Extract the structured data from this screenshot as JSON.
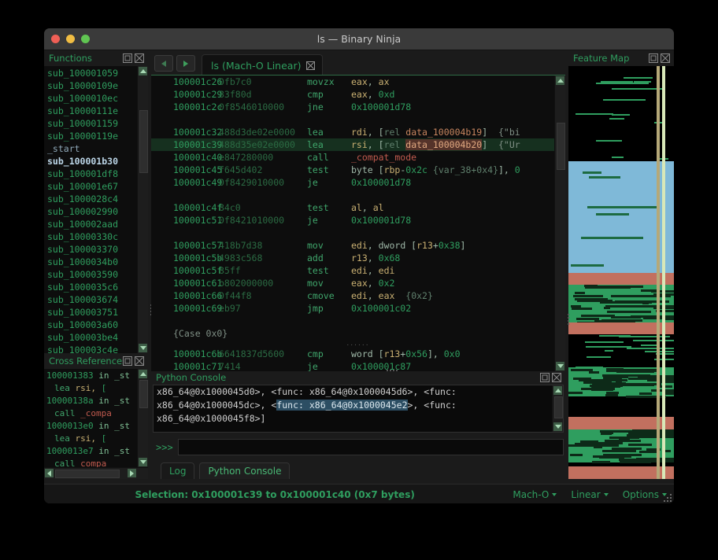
{
  "window": {
    "title": "ls — Binary Ninja",
    "traffic_lights": [
      "close-red",
      "minimize-yellow",
      "maximize-green"
    ]
  },
  "panels": {
    "functions": {
      "title": "Functions",
      "detach_icon": "detach-icon",
      "close_icon": "close-icon"
    },
    "cross_references": {
      "title": "Cross References",
      "detach_icon": "detach-icon",
      "close_icon": "close-icon"
    },
    "python_console": {
      "title": "Python Console",
      "detach_icon": "detach-icon",
      "close_icon": "close-icon"
    },
    "feature_map": {
      "title": "Feature Map",
      "detach_icon": "detach-icon",
      "close_icon": "close-icon"
    }
  },
  "functions_list": [
    {
      "label": "sub_100001059",
      "state": "normal"
    },
    {
      "label": "sub_10000109e",
      "state": "normal"
    },
    {
      "label": "sub_1000010ec",
      "state": "normal"
    },
    {
      "label": "sub_10000111e",
      "state": "normal"
    },
    {
      "label": "sub_100001159",
      "state": "normal"
    },
    {
      "label": "sub_10000119e",
      "state": "normal"
    },
    {
      "label": "_start",
      "state": "symbol"
    },
    {
      "label": "sub_100001b30",
      "state": "current"
    },
    {
      "label": "sub_100001df8",
      "state": "normal"
    },
    {
      "label": "sub_100001e67",
      "state": "normal"
    },
    {
      "label": "sub_1000028c4",
      "state": "normal"
    },
    {
      "label": "sub_100002990",
      "state": "normal"
    },
    {
      "label": "sub_100002aad",
      "state": "normal"
    },
    {
      "label": "sub_10000330c",
      "state": "normal"
    },
    {
      "label": "sub_100003370",
      "state": "normal"
    },
    {
      "label": "sub_1000034b0",
      "state": "normal"
    },
    {
      "label": "sub_100003590",
      "state": "normal"
    },
    {
      "label": "sub_1000035c6",
      "state": "normal"
    },
    {
      "label": "sub_100003674",
      "state": "normal"
    },
    {
      "label": "sub_100003751",
      "state": "normal"
    },
    {
      "label": "sub_100003a60",
      "state": "normal"
    },
    {
      "label": "sub_100003be4",
      "state": "normal"
    },
    {
      "label": "sub_100003c4e",
      "state": "clipped"
    }
  ],
  "tabbar": {
    "back_icon": "arrow-left-icon",
    "forward_icon": "arrow-right-icon",
    "tabs": [
      {
        "label": "ls (Mach-O Linear)",
        "close_icon": "close-icon",
        "active": true
      }
    ]
  },
  "disassembly": [
    {
      "type": "code",
      "addr": "100001c26",
      "bytes": "0fb7c0",
      "mnemonic": "movzx",
      "operands": [
        {
          "t": "reg",
          "v": "eax"
        },
        {
          "t": "plain",
          "v": ", "
        },
        {
          "t": "reg",
          "v": "ax"
        }
      ]
    },
    {
      "type": "code",
      "addr": "100001c29",
      "bytes": "83f80d",
      "mnemonic": "cmp",
      "operands": [
        {
          "t": "reg",
          "v": "eax"
        },
        {
          "t": "plain",
          "v": ", "
        },
        {
          "t": "num",
          "v": "0xd"
        }
      ]
    },
    {
      "type": "code",
      "addr": "100001c2c",
      "bytes": "0f8546010000",
      "mnemonic": "jne",
      "operands": [
        {
          "t": "addr",
          "v": "0x100001d78"
        }
      ]
    },
    {
      "type": "blank"
    },
    {
      "type": "code",
      "addr": "100001c32",
      "bytes": "488d3de02e0000",
      "mnemonic": "lea",
      "operands": [
        {
          "t": "reg",
          "v": "rdi"
        },
        {
          "t": "plain",
          "v": ", ["
        },
        {
          "t": "ann",
          "v": "rel "
        },
        {
          "t": "dref",
          "v": "data_100004b19"
        },
        {
          "t": "plain",
          "v": "]  "
        },
        {
          "t": "cmt",
          "v": "{\"bi"
        }
      ]
    },
    {
      "type": "code",
      "selected": true,
      "addr": "100001c39",
      "bytes": "488d35e02e0000",
      "mnemonic": "lea",
      "operands": [
        {
          "t": "reg",
          "v": "rsi"
        },
        {
          "t": "plain",
          "v": ", ["
        },
        {
          "t": "ann",
          "v": "rel "
        },
        {
          "t": "dref_hl",
          "v": "data_100004b20"
        },
        {
          "t": "plain",
          "v": "]  "
        },
        {
          "t": "cmt",
          "v": "{\"Ur"
        }
      ]
    },
    {
      "type": "code",
      "addr": "100001c40",
      "bytes": "e847280000",
      "mnemonic": "call",
      "operands": [
        {
          "t": "fname",
          "v": "_compat_mode"
        }
      ]
    },
    {
      "type": "code",
      "addr": "100001c45",
      "bytes": "f645d402",
      "mnemonic": "test",
      "operands": [
        {
          "t": "plain",
          "v": "byte ["
        },
        {
          "t": "reg",
          "v": "rbp"
        },
        {
          "t": "plain",
          "v": "-"
        },
        {
          "t": "num",
          "v": "0x2c"
        },
        {
          "t": "plain",
          "v": " "
        },
        {
          "t": "ann",
          "v": "{var_38+0x4}"
        },
        {
          "t": "plain",
          "v": "], "
        },
        {
          "t": "num",
          "v": "0"
        }
      ]
    },
    {
      "type": "code",
      "addr": "100001c49",
      "bytes": "0f8429010000",
      "mnemonic": "je",
      "operands": [
        {
          "t": "addr",
          "v": "0x100001d78"
        }
      ]
    },
    {
      "type": "blank"
    },
    {
      "type": "code",
      "addr": "100001c4f",
      "bytes": "84c0",
      "mnemonic": "test",
      "operands": [
        {
          "t": "reg",
          "v": "al"
        },
        {
          "t": "plain",
          "v": ", "
        },
        {
          "t": "reg",
          "v": "al"
        }
      ]
    },
    {
      "type": "code",
      "addr": "100001c51",
      "bytes": "0f8421010000",
      "mnemonic": "je",
      "operands": [
        {
          "t": "addr",
          "v": "0x100001d78"
        }
      ]
    },
    {
      "type": "blank"
    },
    {
      "type": "code",
      "addr": "100001c57",
      "bytes": "418b7d38",
      "mnemonic": "mov",
      "operands": [
        {
          "t": "reg",
          "v": "edi"
        },
        {
          "t": "plain",
          "v": ", dword ["
        },
        {
          "t": "reg",
          "v": "r13"
        },
        {
          "t": "plain",
          "v": "+"
        },
        {
          "t": "num",
          "v": "0x38"
        },
        {
          "t": "plain",
          "v": "]"
        }
      ]
    },
    {
      "type": "code",
      "addr": "100001c5b",
      "bytes": "4983c568",
      "mnemonic": "add",
      "operands": [
        {
          "t": "reg",
          "v": "r13"
        },
        {
          "t": "plain",
          "v": ", "
        },
        {
          "t": "num",
          "v": "0x68"
        }
      ]
    },
    {
      "type": "code",
      "addr": "100001c5f",
      "bytes": "85ff",
      "mnemonic": "test",
      "operands": [
        {
          "t": "reg",
          "v": "edi"
        },
        {
          "t": "plain",
          "v": ", "
        },
        {
          "t": "reg",
          "v": "edi"
        }
      ]
    },
    {
      "type": "code",
      "addr": "100001c61",
      "bytes": "b802000000",
      "mnemonic": "mov",
      "operands": [
        {
          "t": "reg",
          "v": "eax"
        },
        {
          "t": "plain",
          "v": ", "
        },
        {
          "t": "num",
          "v": "0x2"
        }
      ]
    },
    {
      "type": "code",
      "addr": "100001c66",
      "bytes": "0f44f8",
      "mnemonic": "cmove",
      "operands": [
        {
          "t": "reg",
          "v": "edi"
        },
        {
          "t": "plain",
          "v": ", "
        },
        {
          "t": "reg",
          "v": "eax"
        },
        {
          "t": "plain",
          "v": "  "
        },
        {
          "t": "ann",
          "v": "{0x2}"
        }
      ]
    },
    {
      "type": "code",
      "addr": "100001c69",
      "bytes": "eb97",
      "mnemonic": "jmp",
      "operands": [
        {
          "t": "addr",
          "v": "0x100001c02"
        }
      ]
    },
    {
      "type": "blank"
    },
    {
      "type": "label",
      "text": "{Case 0x0}"
    },
    {
      "type": "code",
      "addr": "100001c6b",
      "bytes": "6641837d5600",
      "mnemonic": "cmp",
      "operands": [
        {
          "t": "plain",
          "v": "word ["
        },
        {
          "t": "reg",
          "v": "r13"
        },
        {
          "t": "plain",
          "v": "+"
        },
        {
          "t": "num",
          "v": "0x56"
        },
        {
          "t": "plain",
          "v": "], "
        },
        {
          "t": "num",
          "v": "0x0"
        }
      ]
    },
    {
      "type": "code",
      "addr": "100001c71",
      "bytes": "7414",
      "mnemonic": "je",
      "operands": [
        {
          "t": "addr",
          "v": "0x100001c87"
        }
      ]
    }
  ],
  "cross_references": [
    {
      "kind": "header",
      "addr": "100001383",
      "in": "in _st"
    },
    {
      "kind": "detail",
      "mnemonic": "lea",
      "operands": "rsi, ["
    },
    {
      "kind": "header",
      "addr": "10000138a",
      "in": "in _st"
    },
    {
      "kind": "detail",
      "mnemonic": "call",
      "target": "_compa"
    },
    {
      "kind": "header",
      "addr": "1000013e0",
      "in": "in _st"
    },
    {
      "kind": "detail",
      "mnemonic": "lea",
      "operands": "rsi, ["
    },
    {
      "kind": "header",
      "addr": "1000013e7",
      "in": "in _st"
    },
    {
      "kind": "detail",
      "mnemonic": "call",
      "target": "compa"
    }
  ],
  "python_console": {
    "output_lines": [
      {
        "segments": [
          {
            "t": "plain",
            "v": "x86_64@0x1000045d0>, <func: x86_64@0x1000045d6>, <func:"
          }
        ]
      },
      {
        "segments": [
          {
            "t": "plain",
            "v": "x86_64@0x1000045dc>, <"
          },
          {
            "t": "hl",
            "v": "func: x86_64@0x1000045e2"
          },
          {
            "t": "plain",
            "v": ">, <func:"
          }
        ]
      },
      {
        "segments": [
          {
            "t": "plain",
            "v": "x86_64@0x1000045f8>]"
          }
        ]
      }
    ],
    "prompt": ">>>",
    "input_value": "",
    "input_placeholder": ""
  },
  "bottom_tabs": [
    {
      "label": "Log",
      "active": false
    },
    {
      "label": "Python Console",
      "active": true
    }
  ],
  "statusbar": {
    "selection": "Selection: 0x100001c39 to 0x100001c40 (0x7 bytes)",
    "items": [
      {
        "label": "Mach-O",
        "caret_icon": "chevron-down-icon"
      },
      {
        "label": "Linear",
        "caret_icon": "chevron-down-icon"
      },
      {
        "label": "Options",
        "caret_icon": "chevron-down-icon"
      }
    ],
    "resize_grip_icon": "resize-grip-icon"
  },
  "colors": {
    "accent_green": "#2f9e5f",
    "data_region_blue": "#7fb9d8",
    "code_region_green": "#2f9e5f",
    "header_region_red": "#c2705f",
    "selection_row": "#16301f",
    "dref_highlight": "#55332a",
    "console_highlight": "#2c4e63",
    "window_chrome": "#3a3a3a",
    "panel_bg": "#1b1b1b",
    "view_bg": "#0d0d0d"
  },
  "feature_map": {
    "marker_position_pct": 88,
    "regions": [
      {
        "name": "symbols-sparse",
        "color": "#000000",
        "top_pct": 0,
        "height_pct": 23
      },
      {
        "name": "data-blue",
        "color": "#7fb9d8",
        "top_pct": 23,
        "height_pct": 27
      },
      {
        "name": "header-red",
        "color": "#c2705f",
        "top_pct": 50,
        "height_pct": 3
      },
      {
        "name": "code-green",
        "color": "#2f9e5f",
        "top_pct": 53,
        "height_pct": 9
      },
      {
        "name": "header-red-2",
        "color": "#c2705f",
        "top_pct": 62,
        "height_pct": 3
      },
      {
        "name": "sparse-black",
        "color": "#000000",
        "top_pct": 65,
        "height_pct": 8
      },
      {
        "name": "code-green-2",
        "color": "#2f9e5f",
        "top_pct": 73,
        "height_pct": 7
      },
      {
        "name": "red-band-3",
        "color": "#c2705f",
        "top_pct": 85,
        "height_pct": 3
      },
      {
        "name": "code-green-3",
        "color": "#2f9e5f",
        "top_pct": 88,
        "height_pct": 8
      },
      {
        "name": "red-band-4",
        "color": "#c2705f",
        "top_pct": 97,
        "height_pct": 3
      }
    ]
  }
}
